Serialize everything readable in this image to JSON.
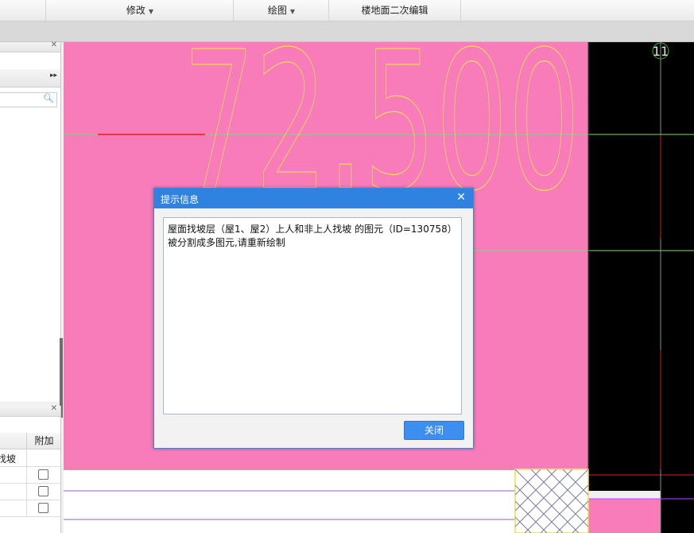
{
  "ribbon": {
    "groups": [
      {
        "label": "修改",
        "has_dropdown": true
      },
      {
        "label": "绘图",
        "has_dropdown": true
      },
      {
        "label": "楼地面二次编辑",
        "has_dropdown": false
      }
    ]
  },
  "left_panel": {
    "table": {
      "column_extra": "附加",
      "rows": [
        {
          "name": "找坡",
          "checked": null
        },
        {
          "name": "",
          "checked": false
        },
        {
          "name": "",
          "checked": false
        },
        {
          "name": "",
          "checked": false
        }
      ]
    }
  },
  "canvas": {
    "elevation_text": "72.500",
    "axis_label": "11",
    "colors": {
      "pink": "#f77cb9",
      "black": "#000000",
      "yellow_outline": "#f6e24a",
      "green_line": "#8fd17a",
      "red_line": "#e02020"
    }
  },
  "dialog": {
    "title": "提示信息",
    "message": "屋面找坡层（屋1、屋2）上人和非上人找坡 的图元（ID=130758）\n被分割成多图元,请重新绘制",
    "close_button": "关闭"
  }
}
